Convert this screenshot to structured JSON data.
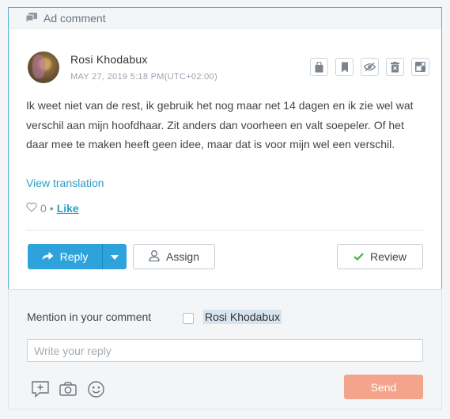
{
  "header": {
    "title": "Ad comment",
    "icon": "comment-icon"
  },
  "comment": {
    "author": "Rosi Khodabux",
    "timestamp": "MAY 27, 2019 5:18 PM(UTC+02:00)",
    "text": "Ik weet niet van de rest, ik gebruik het nog maar net 14 dagen en ik zie wel wat verschil aan mijn hoofdhaar. Zit anders dan voorheen en valt soepeler. Of het daar mee te maken heeft geen idee, maar dat is voor mijn wel een verschil.",
    "view_translation": "View translation",
    "like_count": "0",
    "like_separator": "•",
    "like_label": "Like",
    "tools": [
      "bag-icon",
      "bookmark-icon",
      "hide-icon",
      "delete-icon",
      "export-icon"
    ]
  },
  "actions": {
    "reply_label": "Reply",
    "assign_label": "Assign",
    "review_label": "Review"
  },
  "reply": {
    "mention_label": "Mention in your comment",
    "mention_name": "Rosi Khodabux",
    "mention_checked": false,
    "placeholder": "Write your reply",
    "value": "",
    "send_label": "Send",
    "icons": [
      "add-comment-icon",
      "camera-icon",
      "emoji-icon"
    ]
  },
  "colors": {
    "accent": "#2ea3db",
    "link": "#2a9fc9",
    "send": "#f4a48b",
    "review_check": "#3bb54a",
    "border_focus": "#4cb3cf"
  }
}
